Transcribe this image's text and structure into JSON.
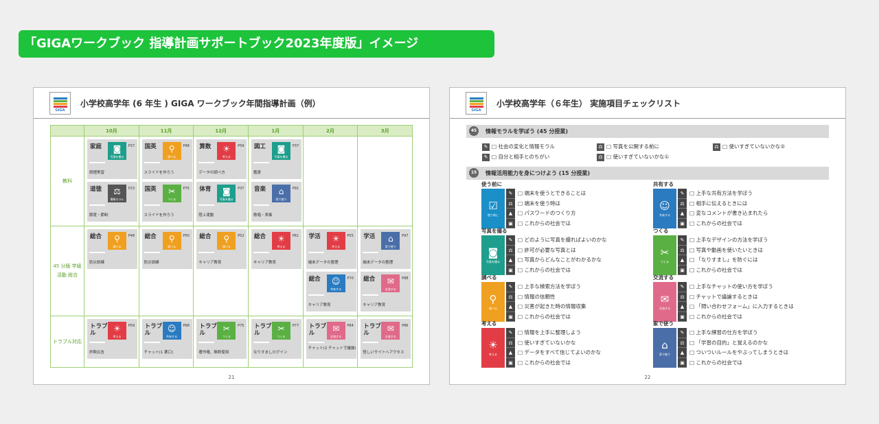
{
  "banner": {
    "title": "「GIGAワークブック 指導計画サポートブック2023年度版」イメージ"
  },
  "colors": {
    "banner": "#1ec33c",
    "picture": "#1e9e8c",
    "search": "#f0a020",
    "create": "#5bb043",
    "share": "#2a7bc0",
    "think": "#e23d46",
    "home": "#4a6ea8",
    "exchange": "#e06a8a",
    "before": "#1a8fc8"
  },
  "logo_text": "GIGA",
  "p1": {
    "title": "小学校高学年 (6 年生 ) GIGA ワークブック年間指導計画（例）",
    "page_number": "21",
    "months": [
      "10月",
      "11月",
      "12月",
      "1月",
      "2月",
      "3月"
    ],
    "rows": [
      {
        "label": "教科"
      },
      {
        "label": "45 分版 学級活動 総合"
      },
      {
        "label": "トラブル対応"
      }
    ],
    "cards": {
      "r0c0a": {
        "subject": "家庭",
        "icon_label": "写真を撮る",
        "page": "P37",
        "topic": "調理実習"
      },
      "r0c0b": {
        "subject": "道徳",
        "icon_label": "情報モラル",
        "page": "P23",
        "topic": "節度・節制"
      },
      "r0c1a": {
        "subject": "国英",
        "icon_label": "調べる",
        "page": "P48",
        "topic": "スライドを作ろう"
      },
      "r0c1b": {
        "subject": "国英",
        "icon_label": "つくる",
        "page": "P75",
        "topic": "スライドを作ろう"
      },
      "r0c2a": {
        "subject": "算数",
        "icon_label": "考える",
        "page": "P59",
        "topic": "データの調べ方"
      },
      "r0c2b": {
        "subject": "体育",
        "icon_label": "写真を撮る",
        "page": "P37",
        "topic": "陸上運動"
      },
      "r0c3a": {
        "subject": "図工",
        "icon_label": "写真を撮る",
        "page": "P37",
        "topic": "鑑賞"
      },
      "r0c3b": {
        "subject": "音楽",
        "icon_label": "家で使う",
        "page": "P91",
        "topic": "歌唱・表奏"
      },
      "r1c0": {
        "subject": "総合",
        "icon_label": "調べる",
        "page": "P48",
        "topic": "防災訓練"
      },
      "r1c1": {
        "subject": "総合",
        "icon_label": "調べる",
        "page": "P50",
        "topic": "防災訓練"
      },
      "r1c2": {
        "subject": "総合",
        "icon_label": "調べる",
        "page": "P52",
        "topic": "キャリア教育"
      },
      "r1c3": {
        "subject": "総合",
        "icon_label": "考える",
        "page": "P61",
        "topic": "キャリア教育"
      },
      "r1c4a": {
        "subject": "学活",
        "icon_label": "考える",
        "page": "P55",
        "topic": "端末データの整理"
      },
      "r1c4b": {
        "subject": "総合",
        "icon_label": "共有する",
        "page": "P70",
        "topic": "キャリア教育"
      },
      "r1c5a": {
        "subject": "学活",
        "icon_label": "家で使う",
        "page": "P97",
        "topic": "端末データの整理"
      },
      "r1c5b": {
        "subject": "総合",
        "icon_label": "交流する",
        "page": "P88",
        "topic": "キャリア教育"
      },
      "r2c0": {
        "subject": "トラブル",
        "icon_label": "考える",
        "page": "P59",
        "topic": "詐欺広告"
      },
      "r2c1": {
        "subject": "トラブル",
        "icon_label": "共有する",
        "page": "P68",
        "topic": "チャット(1 悪口)"
      },
      "r2c2": {
        "subject": "トラブル",
        "icon_label": "つくる",
        "page": "P75",
        "topic": "著作権、無断使用"
      },
      "r2c3": {
        "subject": "トラブル",
        "icon_label": "つくる",
        "page": "P77",
        "topic": "なりすましログイン"
      },
      "r2c4": {
        "subject": "トラブル",
        "icon_label": "交流する",
        "page": "P84",
        "topic": "チャット(2 チャットで議論)"
      },
      "r2c5": {
        "subject": "トラブル",
        "icon_label": "交流する",
        "page": "P86",
        "topic": "怪しいサイトへアクセス"
      }
    }
  },
  "p2": {
    "title": "小学校高学年（６年生） 実施項目チェックリスト",
    "page_number": "22",
    "sec1": {
      "num": "45",
      "title": "情報モラルを学ぼう (45 分授業)",
      "items": [
        "□ 社会の変化と情報モラル",
        "□ 自分と相手とのちがい",
        "□ 写真を公開する前に",
        "□ 使いすぎていないかな①",
        "□ 使いすぎていないかな②"
      ]
    },
    "sec2": {
      "num": "15",
      "title": "情報活用能力を身につけよう (15 分授業)"
    },
    "groups": {
      "g1": {
        "title": "使う前に",
        "box_label": "使う前に",
        "items": [
          "□ 端末を使うとできることは",
          "□ 端末を使う時は",
          "□ パスワードのつくり方",
          "□ これからの社会では"
        ]
      },
      "g2": {
        "title": "写真を撮る",
        "box_label": "写真を撮る",
        "items": [
          "□ どのように写真を撮ればよいのかな",
          "□ 許可が必要な写真とは",
          "□ 写真からどんなことがわかるかな",
          "□ これからの社会では"
        ]
      },
      "g3": {
        "title": "調べる",
        "box_label": "調べる",
        "items": [
          "□ 上手な検索方法を学ぼう",
          "□ 情報の信頼性",
          "□ 災害が起きた時の情報収集",
          "□ これからの社会では"
        ]
      },
      "g4": {
        "title": "考える",
        "box_label": "考える",
        "items": [
          "□ 情報を上手に整理しよう",
          "□ 使いすぎていないかな",
          "□ データをすべて信じてよいのかな",
          "□ これからの社会では"
        ]
      },
      "g5": {
        "title": "共有する",
        "box_label": "共有する",
        "items": [
          "□ 上手な共有方法を学ぼう",
          "□ 相手に伝えるときには",
          "□ 変なコメントが書き込まれたら",
          "□ これからの社会では"
        ]
      },
      "g6": {
        "title": "つくる",
        "box_label": "つくる",
        "items": [
          "□ 上手なデザインの方法を学ぼう",
          "□ 写真や動画を使いたいときは",
          "□ 「なりすまし」を防ぐには",
          "□ これからの社会では"
        ]
      },
      "g7": {
        "title": "交流する",
        "box_label": "交流する",
        "items": [
          "□ 上手なチャットの使い方を学ぼう",
          "□ チャットで議論するときは",
          "□ 「問い合わせフォーム」に入力するときは",
          "□ これからの社会では"
        ]
      },
      "g8": {
        "title": "家で使う",
        "box_label": "家で使う",
        "items": [
          "□ 上手な練習の仕方を学ぼう",
          "□ 「学習の目的」と覚えるのかな",
          "□ ついついルールをやぶってしまうときは",
          "□ これからの社会では"
        ]
      }
    }
  }
}
